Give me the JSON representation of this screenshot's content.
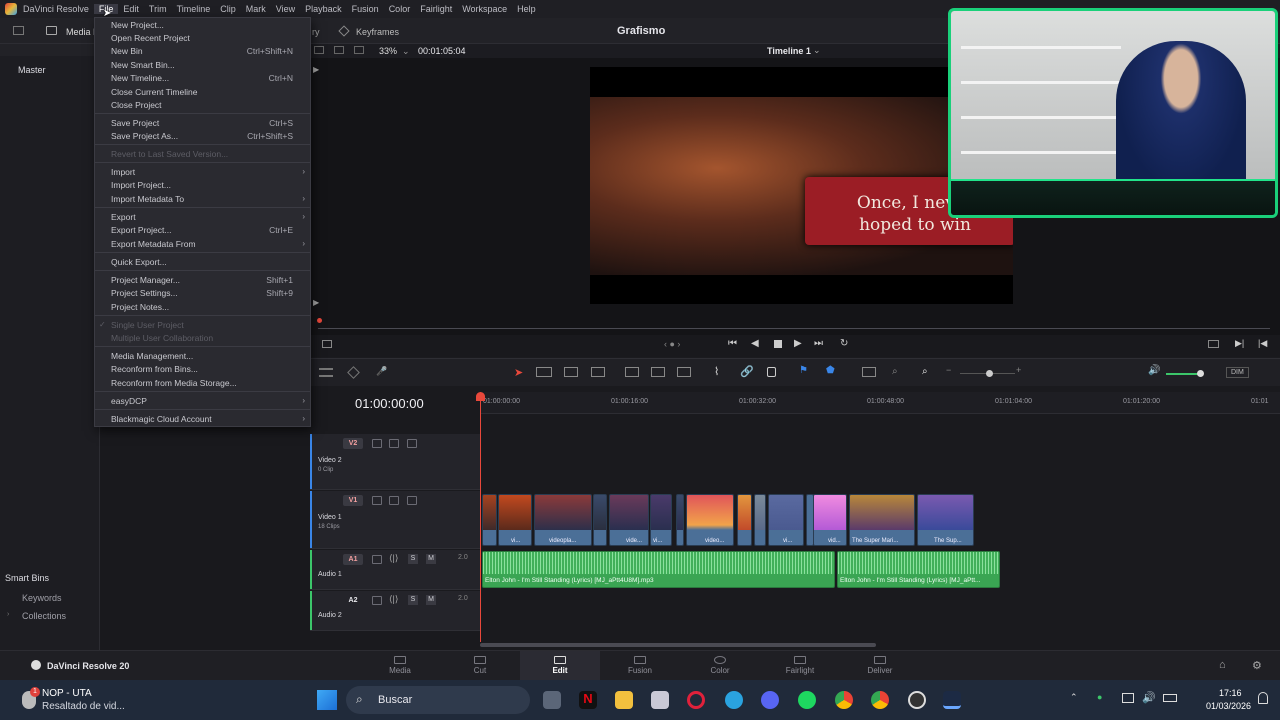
{
  "menubar": {
    "app": "DaVinci Resolve",
    "items": [
      "File",
      "Edit",
      "Trim",
      "Timeline",
      "Clip",
      "Mark",
      "View",
      "Playback",
      "Fusion",
      "Color",
      "Fairlight",
      "Workspace",
      "Help"
    ]
  },
  "toolbar": {
    "media_pool": "Media P",
    "library_partial": "ry",
    "keyframes": "Keyframes",
    "project_title": "Grafismo",
    "zoom": "33%",
    "timecode": "00:01:05:04",
    "timeline_name": "Timeline 1"
  },
  "left_panel": {
    "master": "Master",
    "smart_bins": "Smart Bins",
    "keywords": "Keywords",
    "collections": "Collections"
  },
  "file_menu": {
    "items": [
      {
        "label": "New Project...",
        "shortcut": ""
      },
      {
        "label": "Open Recent Project",
        "shortcut": ""
      },
      {
        "label": "New Bin",
        "shortcut": "Ctrl+Shift+N"
      },
      {
        "label": "New Smart Bin...",
        "shortcut": ""
      },
      {
        "label": "New Timeline...",
        "shortcut": "Ctrl+N"
      },
      {
        "label": "Close Current Timeline",
        "shortcut": ""
      },
      {
        "label": "Close Project",
        "shortcut": ""
      },
      {
        "label": "Save Project",
        "shortcut": "Ctrl+S"
      },
      {
        "label": "Save Project As...",
        "shortcut": "Ctrl+Shift+S"
      },
      {
        "label": "Revert to Last Saved Version...",
        "shortcut": ""
      },
      {
        "label": "Import",
        "shortcut": ""
      },
      {
        "label": "Import Project...",
        "shortcut": ""
      },
      {
        "label": "Import Metadata To",
        "shortcut": ""
      },
      {
        "label": "Export",
        "shortcut": ""
      },
      {
        "label": "Export Project...",
        "shortcut": "Ctrl+E"
      },
      {
        "label": "Export Metadata From",
        "shortcut": ""
      },
      {
        "label": "Quick Export...",
        "shortcut": ""
      },
      {
        "label": "Project Manager...",
        "shortcut": "Shift+1"
      },
      {
        "label": "Project Settings...",
        "shortcut": "Shift+9"
      },
      {
        "label": "Project Notes...",
        "shortcut": ""
      },
      {
        "label": "Single User Project",
        "shortcut": ""
      },
      {
        "label": "Multiple User Collaboration",
        "shortcut": ""
      },
      {
        "label": "Media Management...",
        "shortcut": ""
      },
      {
        "label": "Reconform from Bins...",
        "shortcut": ""
      },
      {
        "label": "Reconform from Media Storage...",
        "shortcut": ""
      },
      {
        "label": "easyDCP",
        "shortcut": ""
      },
      {
        "label": "Blackmagic Cloud Account",
        "shortcut": ""
      }
    ]
  },
  "viewer": {
    "caption_line1": "Once, I never",
    "caption_line2": "hoped to win"
  },
  "timeline": {
    "current_tc": "01:00:00:00",
    "ruler": [
      "01:00:00:00",
      "01:00:16:00",
      "01:00:32:00",
      "01:00:48:00",
      "01:01:04:00",
      "01:01:20:00",
      "01:01"
    ],
    "tracks": {
      "v2_tag": "V2",
      "v2_name": "Video 2",
      "v2_sub": "0 Clip",
      "v1_tag": "V1",
      "v1_name": "Video 1",
      "v1_sub": "18 Clips",
      "a1_tag": "A1",
      "a1_name": "Audio 1",
      "a1_ch": "2.0",
      "a2_tag": "A2",
      "a2_name": "Audio 2",
      "a2_ch": "2.0",
      "solo": "S",
      "mute": "M"
    },
    "video_clip_labels": [
      "vi...",
      "videopla...",
      "vide...",
      "vi...",
      "video...",
      "vi...",
      "vid...",
      "The Super Mari...",
      "The Sup..."
    ],
    "audio_clip_1": "Elton John - I'm Still Standing (Lyrics) [MJ_aPtt4U8M].mp3",
    "audio_clip_2": "Elton John - I'm Still Standing (Lyrics) [MJ_aPtt...",
    "dim": "DIM"
  },
  "pages": {
    "brand": "DaVinci Resolve 20",
    "items": [
      "Media",
      "Cut",
      "Edit",
      "Fusion",
      "Color",
      "Fairlight",
      "Deliver"
    ],
    "active": "Edit"
  },
  "taskbar": {
    "notif_title": "NOP - UTA",
    "notif_sub": "Resaltado de vid...",
    "notif_badge": "1",
    "search": "Buscar",
    "time": "17:16",
    "date": "01/03/2026"
  }
}
